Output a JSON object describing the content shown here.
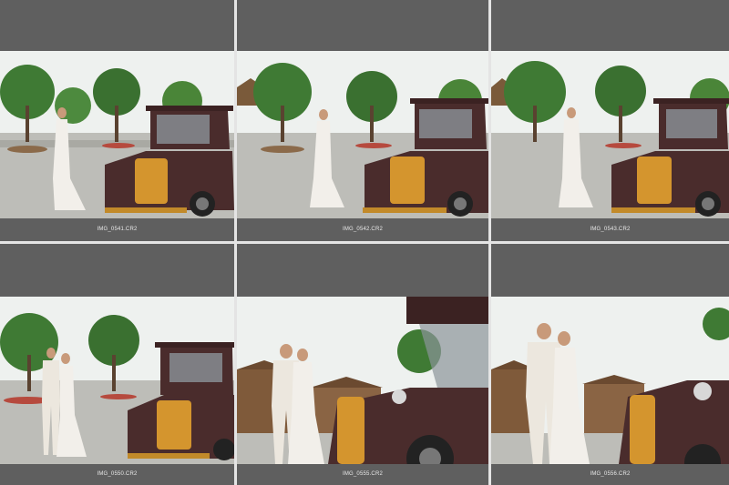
{
  "thumbnails": [
    {
      "filename": "IMG_0541.CR2"
    },
    {
      "filename": "IMG_0542.CR2"
    },
    {
      "filename": "IMG_0543.CR2"
    },
    {
      "filename": "IMG_0550.CR2"
    },
    {
      "filename": "IMG_0555.CR2"
    },
    {
      "filename": "IMG_0556.CR2"
    }
  ],
  "colors": {
    "cell_background": "#5f5f5f",
    "grid_gap": "#e4e4e4",
    "filename_text": "#e8e8e8",
    "car_body": "#4a2c2c",
    "car_grille": "#d4952e",
    "sky": "#eef1ef",
    "pavement": "#bdbdb8",
    "tree": "#3f7a34"
  }
}
